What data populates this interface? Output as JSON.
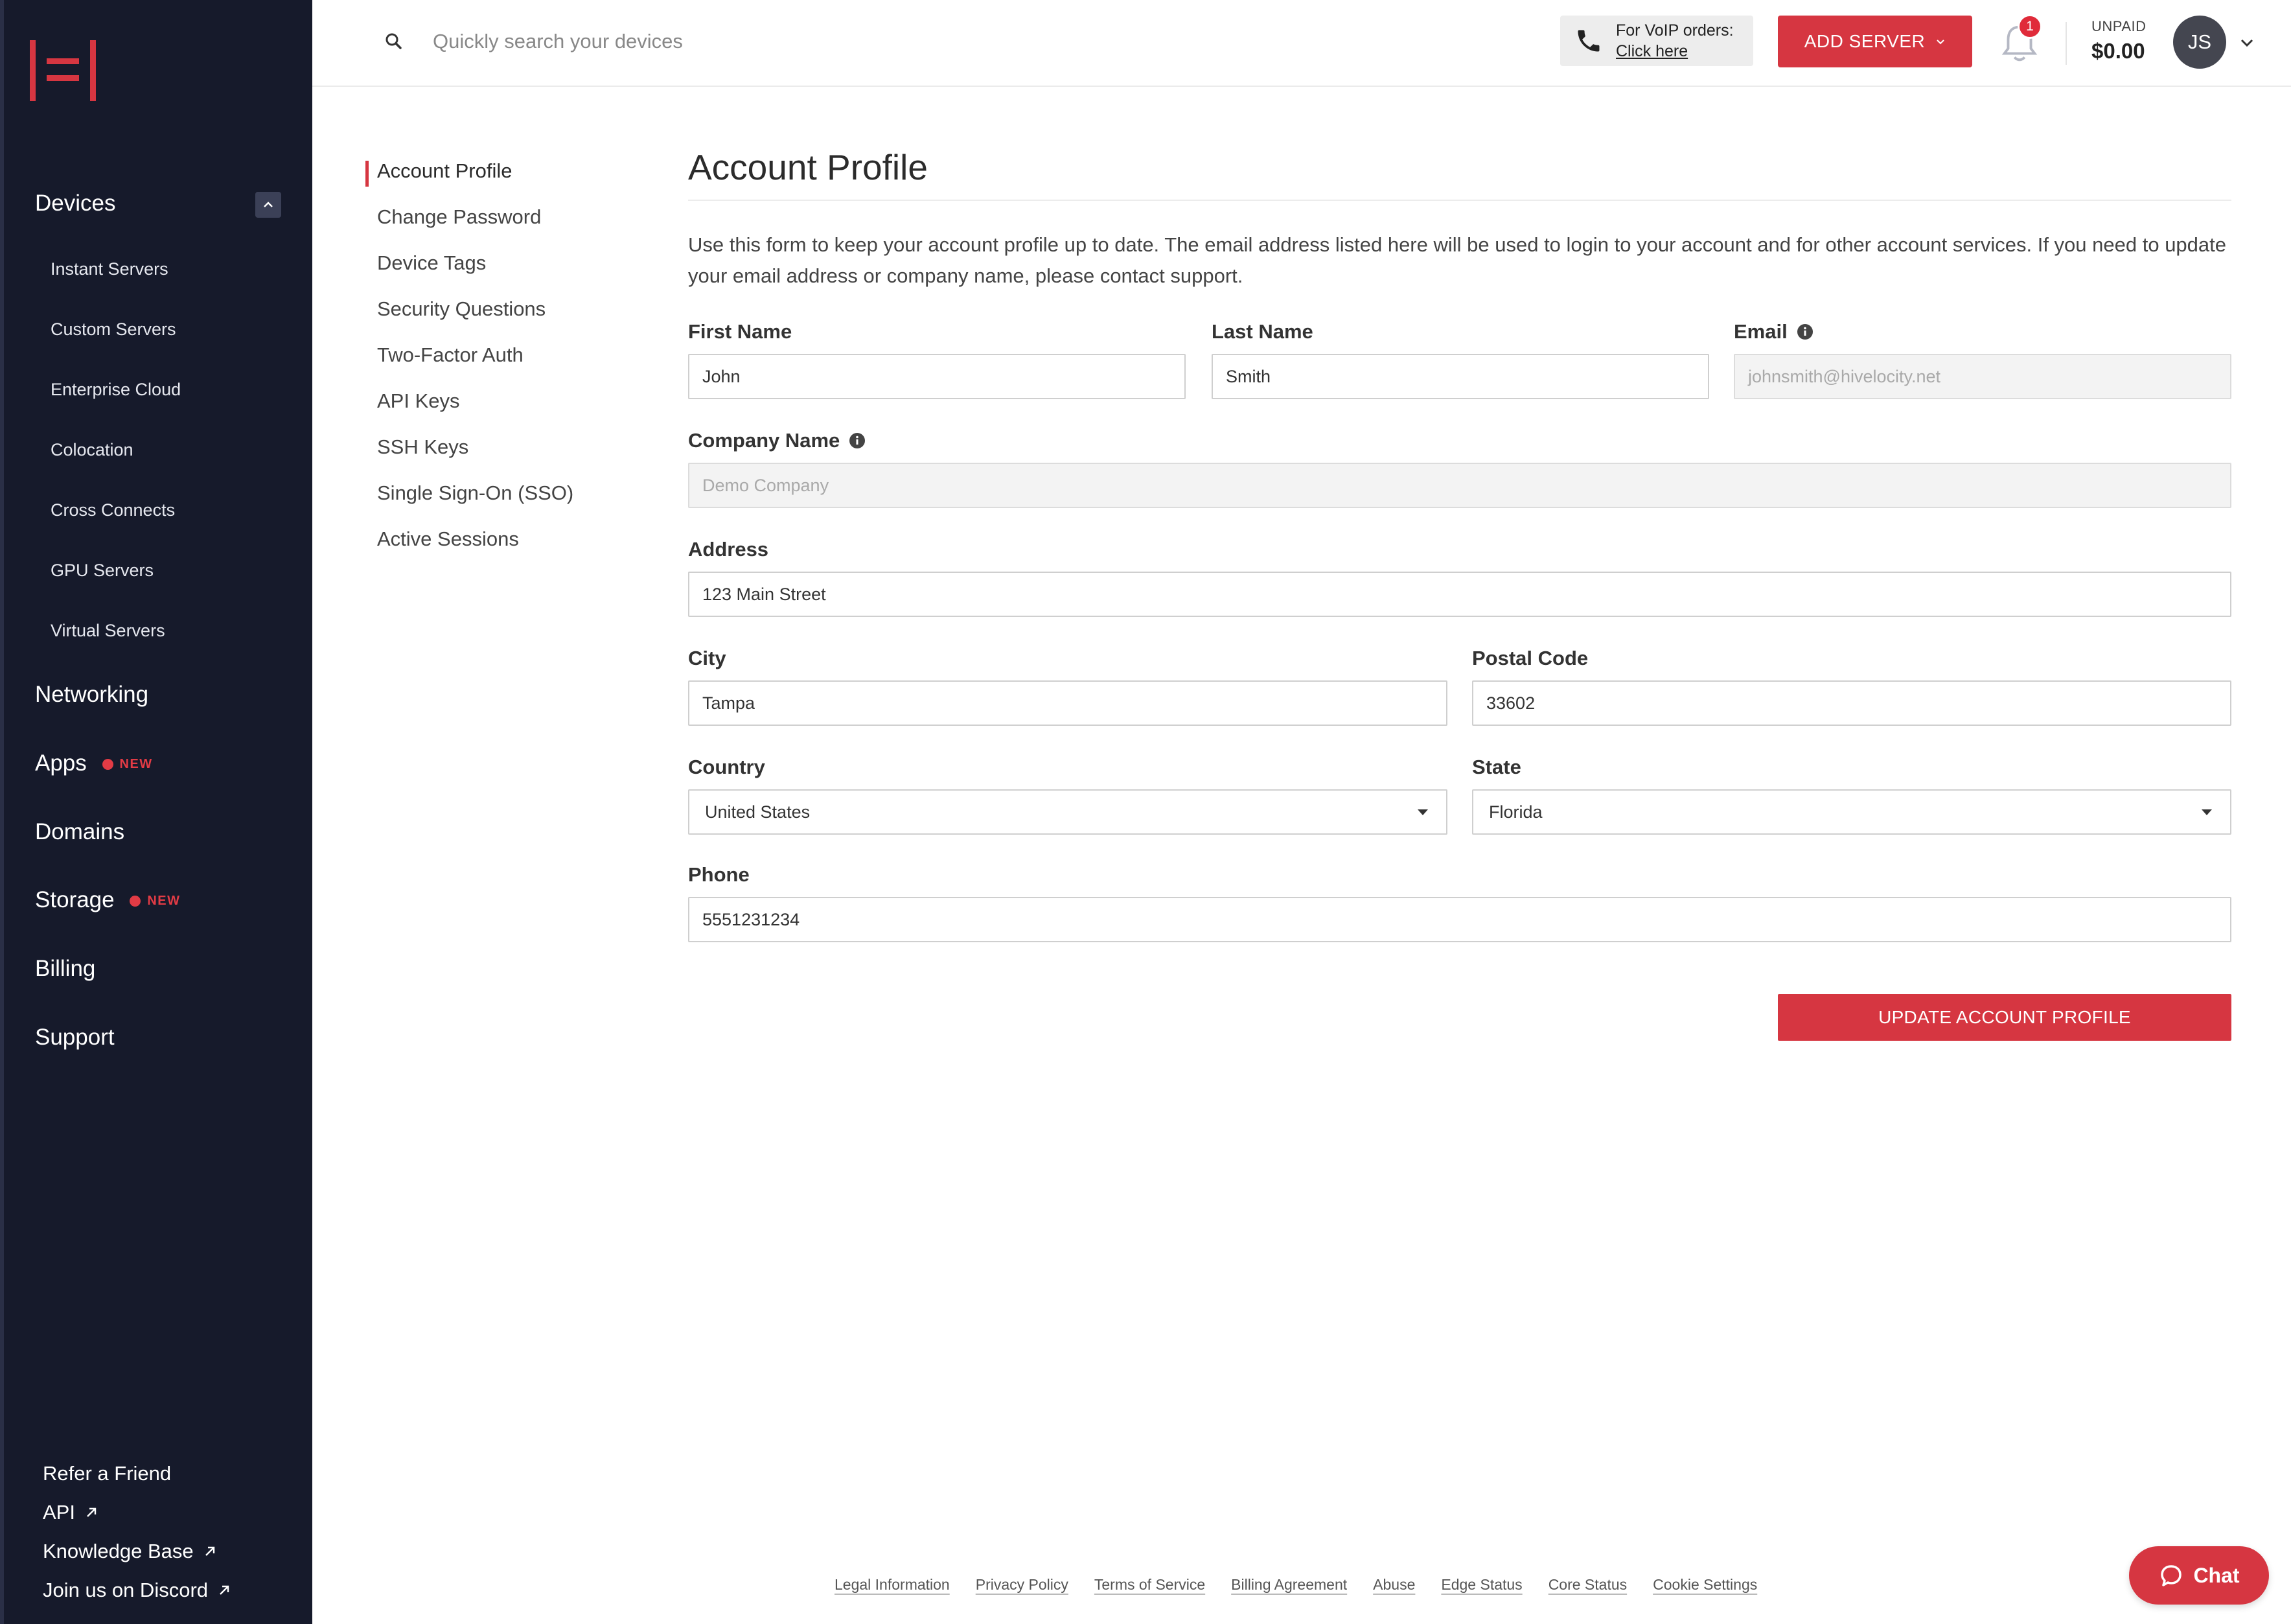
{
  "sidebar": {
    "sections": [
      {
        "label": "Devices"
      },
      {
        "label": "Networking"
      },
      {
        "label": "Apps",
        "badge": "NEW"
      },
      {
        "label": "Domains"
      },
      {
        "label": "Storage",
        "badge": "NEW"
      },
      {
        "label": "Billing"
      },
      {
        "label": "Support"
      }
    ],
    "device_items": [
      "Instant Servers",
      "Custom Servers",
      "Enterprise Cloud",
      "Colocation",
      "Cross Connects",
      "GPU Servers",
      "Virtual Servers"
    ],
    "bottom_links": [
      "Refer a Friend",
      "API",
      "Knowledge Base",
      "Join us on Discord"
    ]
  },
  "topbar": {
    "search_placeholder": "Quickly search your devices",
    "voip_title": "For VoIP orders:",
    "voip_link": "Click here",
    "add_server": "ADD SERVER",
    "notification_count": "1",
    "unpaid_label": "UNPAID",
    "unpaid_value": "$0.00",
    "avatar_initials": "JS"
  },
  "subnav": {
    "items": [
      "Account Profile",
      "Change Password",
      "Device Tags",
      "Security Questions",
      "Two-Factor Auth",
      "API Keys",
      "SSH Keys",
      "Single Sign-On (SSO)",
      "Active Sessions"
    ],
    "active": "Account Profile"
  },
  "form": {
    "title": "Account Profile",
    "description": "Use this form to keep your account profile up to date. The email address listed here will be used to login to your account and for other account services. If you need to update your email address or company name, please contact support.",
    "first_name_label": "First Name",
    "first_name": "John",
    "last_name_label": "Last Name",
    "last_name": "Smith",
    "email_label": "Email",
    "email": "johnsmith@hivelocity.net",
    "company_label": "Company Name",
    "company": "Demo Company",
    "address_label": "Address",
    "address": "123 Main Street",
    "city_label": "City",
    "city": "Tampa",
    "postal_label": "Postal Code",
    "postal": "33602",
    "country_label": "Country",
    "country": "United States",
    "state_label": "State",
    "state": "Florida",
    "phone_label": "Phone",
    "phone": "5551231234",
    "submit": "UPDATE ACCOUNT PROFILE"
  },
  "footer": {
    "links": [
      "Legal Information",
      "Privacy Policy",
      "Terms of Service",
      "Billing Agreement",
      "Abuse",
      "Edge Status",
      "Core Status",
      "Cookie Settings"
    ]
  },
  "chat": {
    "label": "Chat"
  },
  "colors": {
    "accent": "#d63641",
    "sidebar": "#161a2b"
  }
}
